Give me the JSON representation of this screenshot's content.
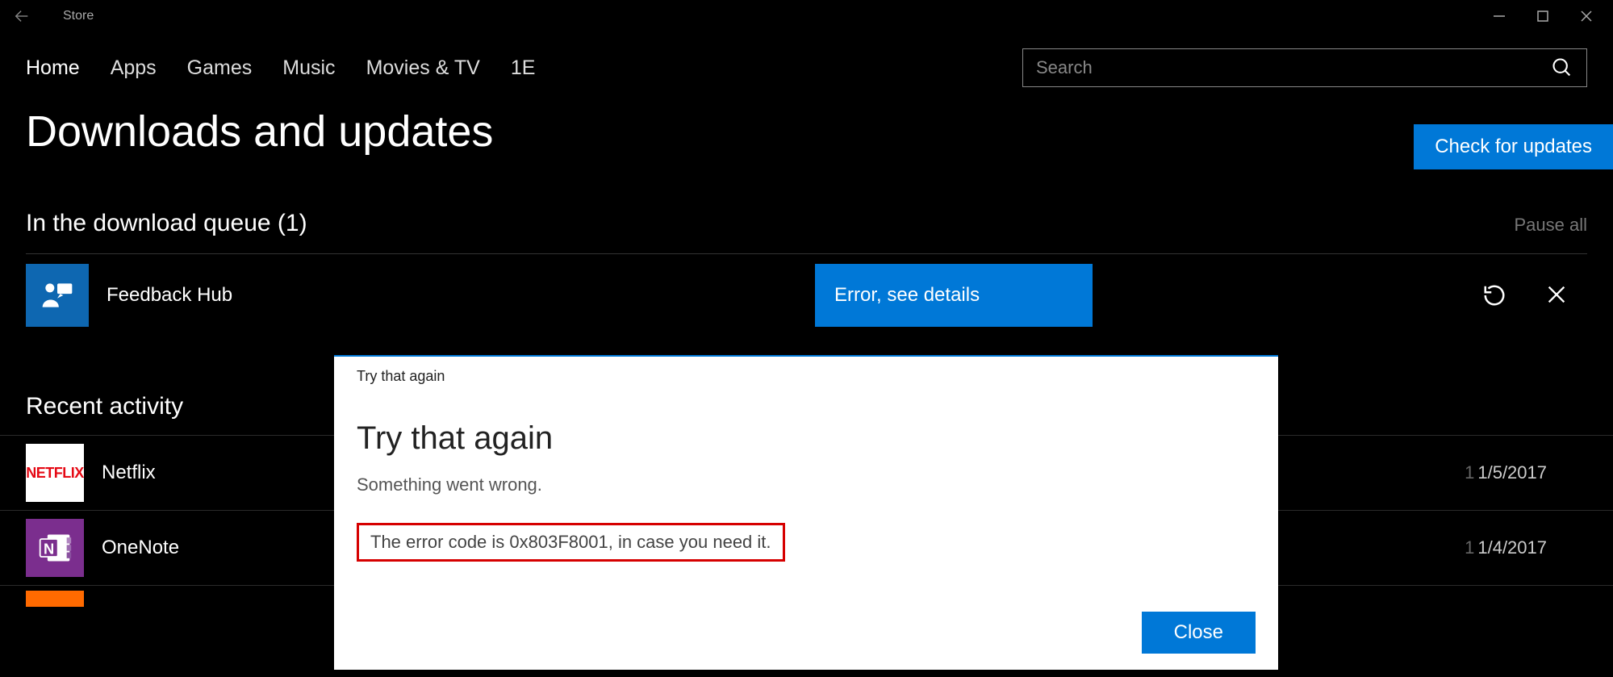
{
  "window": {
    "app_title": "Store"
  },
  "nav": {
    "items": [
      "Home",
      "Apps",
      "Games",
      "Music",
      "Movies & TV",
      "1E"
    ],
    "active_index": 0
  },
  "search": {
    "placeholder": "Search"
  },
  "page": {
    "title": "Downloads and updates",
    "check_updates_label": "Check for updates"
  },
  "queue": {
    "section_title": "In the download queue (1)",
    "pause_label": "Pause all",
    "item": {
      "name": "Feedback Hub",
      "status": "Error, see details"
    }
  },
  "recent": {
    "title": "Recent activity",
    "rows": [
      {
        "name": "Netflix",
        "date": "1/5/2017",
        "prefix": "1"
      },
      {
        "name": "OneNote",
        "date": "1/4/2017",
        "prefix": "1"
      }
    ]
  },
  "dialog": {
    "small_title": "Try that again",
    "title": "Try that again",
    "subtitle": "Something went wrong.",
    "error_text": "The error code is 0x803F8001, in case you need it.",
    "close_label": "Close"
  },
  "colors": {
    "accent": "#0078d7",
    "error_border": "#d60000"
  }
}
